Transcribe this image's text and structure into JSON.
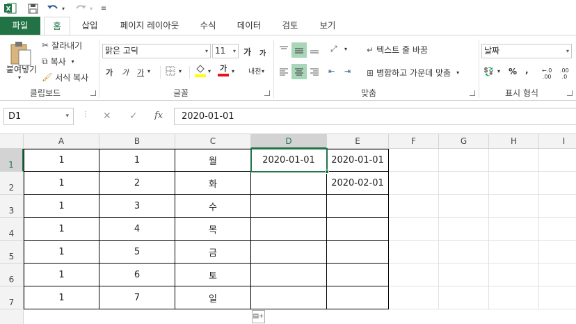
{
  "qat": {
    "app_icon": "excel-logo-icon",
    "save_icon": "save-icon",
    "undo_icon": "undo-icon",
    "redo_icon": "redo-icon",
    "customize_icon": "customize-qat-icon"
  },
  "tabs": [
    "파일",
    "홈",
    "삽입",
    "페이지 레이아웃",
    "수식",
    "데이터",
    "검토",
    "보기"
  ],
  "ribbon": {
    "clipboard": {
      "paste": "붙여넣기",
      "cut": "잘라내기",
      "copy": "복사",
      "format_painter": "서식 복사",
      "label": "클립보드"
    },
    "font": {
      "name": "맑은 고딕",
      "size": "11",
      "grow": "가",
      "shrink": "가",
      "bold": "가",
      "italic": "가",
      "underline": "가",
      "font_color_glyph": "가",
      "phonetic": "내천",
      "label": "글꼴"
    },
    "align": {
      "wrap": "텍스트 줄 바꿈",
      "merge": "병합하고 가운데 맞춤",
      "label": "맞춤"
    },
    "number": {
      "format": "날짜",
      "percent": "%",
      "comma": ",",
      "inc_decimal": ".00",
      "dec_decimal": ".0",
      "label": "표시 형식"
    }
  },
  "formula_bar": {
    "name_box": "D1",
    "cancel": "✕",
    "enter": "✓",
    "fx": "fx",
    "content": "2020-01-01"
  },
  "columns": [
    "A",
    "B",
    "C",
    "D",
    "E",
    "F",
    "G",
    "H",
    "I"
  ],
  "selected_column": "D",
  "selected_row": "1",
  "rows": [
    {
      "num": "1",
      "A": "1",
      "B": "1",
      "C": "월",
      "D": "2020-01-01",
      "E": "2020-01-01"
    },
    {
      "num": "2",
      "A": "1",
      "B": "2",
      "C": "화",
      "D": "",
      "E": "2020-02-01"
    },
    {
      "num": "3",
      "A": "1",
      "B": "3",
      "C": "수",
      "D": "",
      "E": ""
    },
    {
      "num": "4",
      "A": "1",
      "B": "4",
      "C": "목",
      "D": "",
      "E": ""
    },
    {
      "num": "5",
      "A": "1",
      "B": "5",
      "C": "금",
      "D": "",
      "E": ""
    },
    {
      "num": "6",
      "A": "1",
      "B": "6",
      "C": "토",
      "D": "",
      "E": ""
    },
    {
      "num": "7",
      "A": "1",
      "B": "7",
      "C": "일",
      "D": "",
      "E": ""
    }
  ],
  "colors": {
    "accent": "#217346",
    "highlight": "#a9d6b9"
  }
}
